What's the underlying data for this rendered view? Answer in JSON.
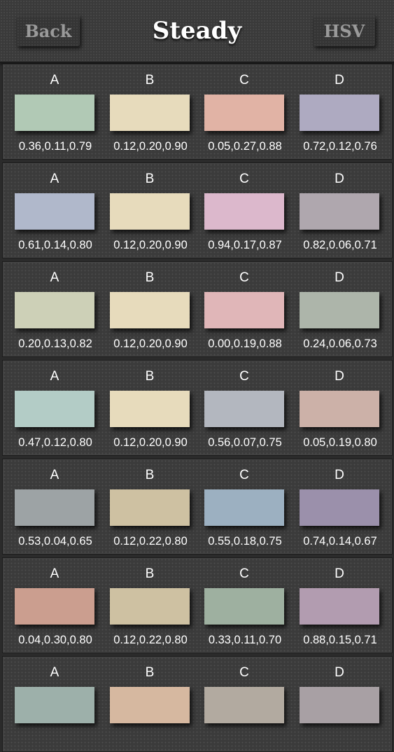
{
  "header": {
    "back_label": "Back",
    "title": "Steady",
    "hsv_label": "HSV"
  },
  "schemes": [
    {
      "colors": [
        {
          "label": "A",
          "hsv": "0.36,0.11,0.79",
          "color": "#b1c9b5"
        },
        {
          "label": "B",
          "hsv": "0.12,0.20,0.90",
          "color": "#e7dbbc"
        },
        {
          "label": "C",
          "hsv": "0.05,0.27,0.88",
          "color": "#e1b3a5"
        },
        {
          "label": "D",
          "hsv": "0.72,0.12,0.76",
          "color": "#aeaac1"
        }
      ]
    },
    {
      "colors": [
        {
          "label": "A",
          "hsv": "0.61,0.14,0.80",
          "color": "#b0b8cb"
        },
        {
          "label": "B",
          "hsv": "0.12,0.20,0.90",
          "color": "#e7dbbc"
        },
        {
          "label": "C",
          "hsv": "0.94,0.17,0.87",
          "color": "#dcb8cc"
        },
        {
          "label": "D",
          "hsv": "0.82,0.06,0.71",
          "color": "#afa7ae"
        }
      ]
    },
    {
      "colors": [
        {
          "label": "A",
          "hsv": "0.20,0.13,0.82",
          "color": "#cdd0b7"
        },
        {
          "label": "B",
          "hsv": "0.12,0.20,0.90",
          "color": "#e7dbbc"
        },
        {
          "label": "C",
          "hsv": "0.00,0.19,0.88",
          "color": "#e0b6b8"
        },
        {
          "label": "D",
          "hsv": "0.24,0.06,0.73",
          "color": "#adb5aa"
        }
      ]
    },
    {
      "colors": [
        {
          "label": "A",
          "hsv": "0.47,0.12,0.80",
          "color": "#b3ccc6"
        },
        {
          "label": "B",
          "hsv": "0.12,0.20,0.90",
          "color": "#e7dbbc"
        },
        {
          "label": "C",
          "hsv": "0.56,0.07,0.75",
          "color": "#b3b7bf"
        },
        {
          "label": "D",
          "hsv": "0.05,0.19,0.80",
          "color": "#ccb1a8"
        }
      ]
    },
    {
      "colors": [
        {
          "label": "A",
          "hsv": "0.53,0.04,0.65",
          "color": "#9da3a5"
        },
        {
          "label": "B",
          "hsv": "0.12,0.22,0.80",
          "color": "#cec1a2"
        },
        {
          "label": "C",
          "hsv": "0.55,0.18,0.75",
          "color": "#9cb0c1"
        },
        {
          "label": "D",
          "hsv": "0.74,0.14,0.67",
          "color": "#9b90ab"
        }
      ]
    },
    {
      "colors": [
        {
          "label": "A",
          "hsv": "0.04,0.30,0.80",
          "color": "#cb9e8f"
        },
        {
          "label": "B",
          "hsv": "0.12,0.22,0.80",
          "color": "#cec1a2"
        },
        {
          "label": "C",
          "hsv": "0.33,0.11,0.70",
          "color": "#9eb0a0"
        },
        {
          "label": "D",
          "hsv": "0.88,0.15,0.71",
          "color": "#b29cb0"
        }
      ]
    },
    {
      "colors": [
        {
          "label": "A",
          "hsv": "",
          "color": "#9db0aa"
        },
        {
          "label": "B",
          "hsv": "",
          "color": "#d6b8a0"
        },
        {
          "label": "C",
          "hsv": "",
          "color": "#b2aaa0"
        },
        {
          "label": "D",
          "hsv": "",
          "color": "#a8a0a4"
        }
      ]
    }
  ]
}
